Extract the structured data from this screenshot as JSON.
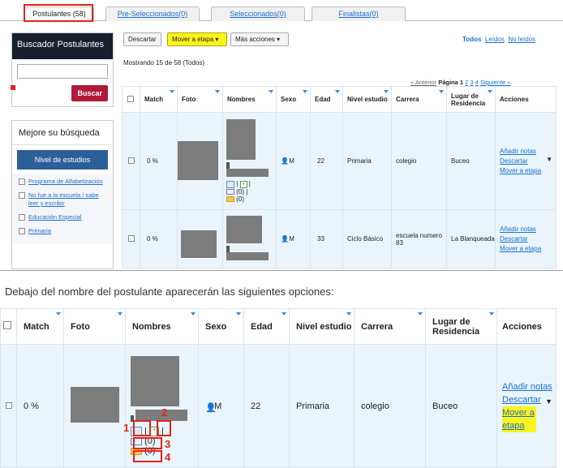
{
  "tabs": [
    {
      "label": "Postulantes (58)"
    },
    {
      "label": "Pre-Seleccionados(0)"
    },
    {
      "label": "Seleccionados(0)"
    },
    {
      "label": "Finalistas(0)"
    }
  ],
  "search": {
    "title": "Buscador Postulantes",
    "button": "Buscar",
    "input_value": ""
  },
  "refine": {
    "title": "Mejore su búsqueda",
    "section": "Nivel de estudios",
    "options": [
      "Programa de Alfabetización",
      "No fue a la escuela / sabe leer y escribir",
      "Educación Especial",
      "Primaria"
    ]
  },
  "toolbar": {
    "descartar": "Descartar",
    "mover": "Mover a etapa",
    "mas": "Más acciones"
  },
  "filters": {
    "todos": "Todos",
    "leidos": "Leídos",
    "no_leidos": "No leídos"
  },
  "showing": "Mostrando 15 de 58 (Todos)",
  "pagination": {
    "prev": "« Anterior",
    "label": "Página",
    "current": "1",
    "p2": "2",
    "p3": "3",
    "p4": "4",
    "next": "Siguiente »"
  },
  "columns": [
    "Match",
    "Foto",
    "Nombres",
    "Sexo",
    "Edad",
    "Nivel estudio",
    "Carrera",
    "Lugar de Residencia",
    "Acciones"
  ],
  "rows": [
    {
      "match": "0 %",
      "sexo": "M",
      "edad": "22",
      "nivel": "Primaria",
      "carrera": "colegio",
      "lugar": "Buceo",
      "mail_count": "(0)",
      "folder_count": "(0)"
    },
    {
      "match": "0 %",
      "sexo": "M",
      "edad": "33",
      "nivel": "Ciclo Básico",
      "carrera": "escuela numero 83",
      "lugar": "La Blanqueada"
    }
  ],
  "actions": {
    "anadir": "Añadir notas",
    "descartar": "Descartar",
    "mover": "Mover a etapa"
  },
  "caption": "Debajo del nombre del postulante aparecerán las siguientes opciones:",
  "zoom_row": {
    "match": "0 %",
    "sexo": "M",
    "edad": "22",
    "nivel": "Primaria",
    "carrera": "colegio",
    "lugar": "Buceo",
    "mail_count": "(0)",
    "folder_count": "(0)"
  },
  "markers": [
    "1",
    "2",
    "3",
    "4"
  ]
}
